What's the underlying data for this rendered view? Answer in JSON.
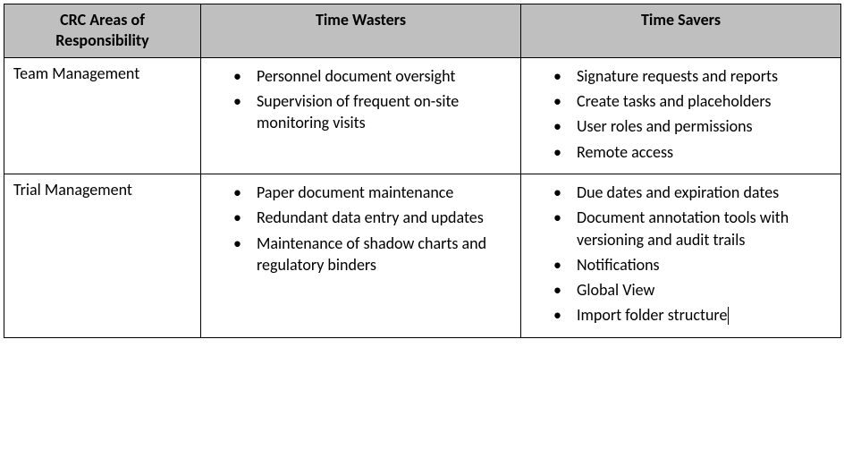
{
  "headers": {
    "col1_line1": "CRC Areas of",
    "col1_line2": "Responsibility",
    "col2": "Time Wasters",
    "col3": "Time Savers"
  },
  "rows": [
    {
      "area": "Team Management",
      "wasters": [
        "Personnel document oversight",
        "Supervision of frequent on-site monitoring visits"
      ],
      "savers": [
        "Signature requests and reports",
        "Create tasks and placeholders",
        "User roles and permissions",
        "Remote access"
      ]
    },
    {
      "area": "Trial Management",
      "wasters": [
        "Paper document maintenance",
        "Redundant data entry and updates",
        "Maintenance of shadow charts and regulatory binders"
      ],
      "savers": [
        "Due dates and expiration dates",
        "Document annotation tools with versioning and audit trails",
        "Notifications",
        "Global View",
        "Import folder structure"
      ]
    }
  ]
}
